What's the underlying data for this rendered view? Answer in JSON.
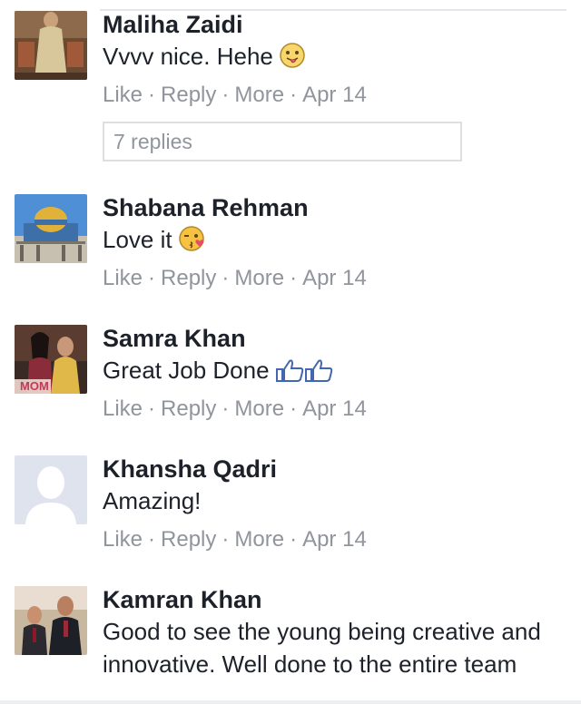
{
  "comments": [
    {
      "name": "Maliha Zaidi",
      "text": "Vvvv nice. Hehe",
      "emoji": "tongue-out-emoji",
      "actions": {
        "like": "Like",
        "reply": "Reply",
        "more": "More",
        "date": "Apr 14"
      },
      "replies": "7 replies"
    },
    {
      "name": "Shabana Rehman",
      "text": "Love it",
      "emoji": "kissing-wink-emoji",
      "actions": {
        "like": "Like",
        "reply": "Reply",
        "more": "More",
        "date": "Apr 14"
      }
    },
    {
      "name": "Samra Khan",
      "text": "Great Job Done",
      "emoji": "thumbs-up-emoji",
      "avatar_caption": "MOM",
      "actions": {
        "like": "Like",
        "reply": "Reply",
        "more": "More",
        "date": "Apr 14"
      }
    },
    {
      "name": "Khansha Qadri",
      "text": "Amazing!",
      "actions": {
        "like": "Like",
        "reply": "Reply",
        "more": "More",
        "date": "Apr 14"
      }
    },
    {
      "name": "Kamran Khan",
      "text": "Good to see the young being creative and innovative. Well done to the entire team"
    }
  ],
  "colors": {
    "name": "#1d2129",
    "meta": "#90949c",
    "border": "#dddfe2",
    "avatar_default_bg": "#dfe3ee"
  }
}
